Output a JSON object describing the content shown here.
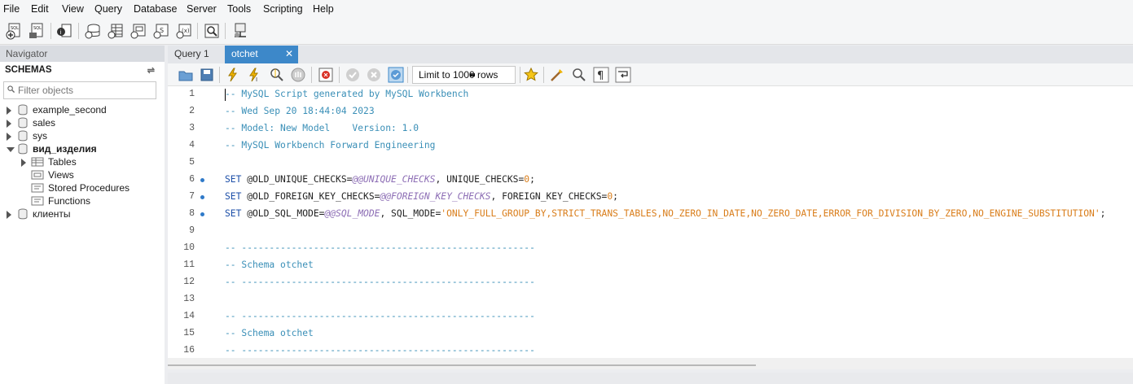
{
  "menu": [
    "File",
    "Edit",
    "View",
    "Query",
    "Database",
    "Server",
    "Tools",
    "Scripting",
    "Help"
  ],
  "navigator": {
    "title": "Navigator",
    "schemas_label": "SCHEMAS",
    "filter_placeholder": "Filter objects",
    "schemas": [
      {
        "name": "example_second",
        "expanded": false
      },
      {
        "name": "sales",
        "expanded": false
      },
      {
        "name": "sys",
        "expanded": false
      },
      {
        "name": "вид_изделия",
        "expanded": true,
        "bold": true,
        "children": [
          "Tables",
          "Views",
          "Stored Procedures",
          "Functions"
        ]
      },
      {
        "name": "клиенты",
        "expanded": false
      }
    ]
  },
  "tabs": [
    {
      "label": "Query 1",
      "active": false
    },
    {
      "label": "otchet",
      "active": true,
      "close": "✕"
    }
  ],
  "sql_toolbar": {
    "limit_value": "Limit to 1000 rows"
  },
  "editor": {
    "lines": [
      {
        "n": "1",
        "marker": false
      },
      {
        "n": "2",
        "marker": false
      },
      {
        "n": "3",
        "marker": false
      },
      {
        "n": "4",
        "marker": false
      },
      {
        "n": "5",
        "marker": false
      },
      {
        "n": "6",
        "marker": true
      },
      {
        "n": "7",
        "marker": true
      },
      {
        "n": "8",
        "marker": true
      },
      {
        "n": "9",
        "marker": false
      },
      {
        "n": "10",
        "marker": false
      },
      {
        "n": "11",
        "marker": false
      },
      {
        "n": "12",
        "marker": false
      },
      {
        "n": "13",
        "marker": false
      },
      {
        "n": "14",
        "marker": false
      },
      {
        "n": "15",
        "marker": false
      },
      {
        "n": "16",
        "marker": false
      }
    ],
    "text": {
      "l1": "-- MySQL Script generated by MySQL Workbench",
      "l2": "-- Wed Sep 20 18:44:04 2023",
      "l3": "-- Model: New Model    Version: 1.0",
      "l4": "-- MySQL Workbench Forward Engineering",
      "set": "SET",
      "l6a": " @OLD_UNIQUE_CHECKS=",
      "l6b": "@@UNIQUE_CHECKS",
      "l6c": ", UNIQUE_CHECKS=",
      "l6d": "0",
      "l6e": ";",
      "l7a": " @OLD_FOREIGN_KEY_CHECKS=",
      "l7b": "@@FOREIGN_KEY_CHECKS",
      "l7c": ", FOREIGN_KEY_CHECKS=",
      "l7d": "0",
      "l7e": ";",
      "l8a": " @OLD_SQL_MODE=",
      "l8b": "@@SQL_MODE",
      "l8c": ", SQL_MODE=",
      "l8d": "'ONLY_FULL_GROUP_BY,STRICT_TRANS_TABLES,NO_ZERO_IN_DATE,NO_ZERO_DATE,ERROR_FOR_DIVISION_BY_ZERO,NO_ENGINE_SUBSTITUTION'",
      "l8e": ";",
      "dash": "-- -----------------------------------------------------",
      "schema": "-- Schema otchet"
    }
  },
  "colors": {
    "accent": "#3d88c9",
    "comment": "#3a8fb7",
    "keyword": "#1d4fa8",
    "string": "#d97d1a"
  }
}
